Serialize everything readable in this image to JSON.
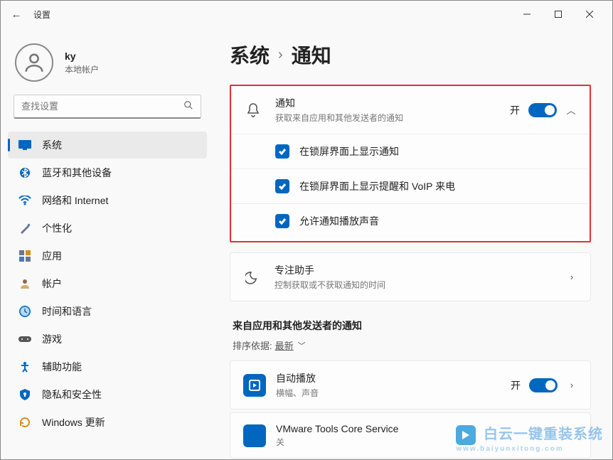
{
  "window": {
    "title": "设置"
  },
  "user": {
    "name": "ky",
    "type": "本地帐户"
  },
  "search": {
    "placeholder": "查找设置"
  },
  "nav": {
    "items": [
      {
        "label": "系统",
        "iconColor": "#0067c0"
      },
      {
        "label": "蓝牙和其他设备",
        "iconColor": "#0067c0"
      },
      {
        "label": "网络和 Internet",
        "iconColor": "#0067c0"
      },
      {
        "label": "个性化",
        "iconColor": "#6b768f"
      },
      {
        "label": "应用",
        "iconColor": "#6b768f"
      },
      {
        "label": "帐户",
        "iconColor": "#8c6a4f"
      },
      {
        "label": "时间和语言",
        "iconColor": "#0067c0"
      },
      {
        "label": "游戏",
        "iconColor": "#777"
      },
      {
        "label": "辅助功能",
        "iconColor": "#0067c0"
      },
      {
        "label": "隐私和安全性",
        "iconColor": "#0067c0"
      },
      {
        "label": "Windows 更新",
        "iconColor": "#d88b1e"
      }
    ]
  },
  "breadcrumb": {
    "root": "系统",
    "current": "通知"
  },
  "notifications": {
    "title": "通知",
    "subtitle": "获取来自应用和其他发送者的通知",
    "stateLabel": "开",
    "options": [
      "在锁屏界面上显示通知",
      "在锁屏界面上显示提醒和 VoIP 来电",
      "允许通知播放声音"
    ]
  },
  "focus": {
    "title": "专注助手",
    "subtitle": "控制获取或不获取通知的时间"
  },
  "senders": {
    "title": "来自应用和其他发送者的通知",
    "sortPrefix": "排序依据:",
    "sortValue": "最新",
    "apps": [
      {
        "name": "自动播放",
        "desc": "横幅、声音",
        "state": "开"
      },
      {
        "name": "VMware Tools Core Service",
        "desc": "关",
        "state": ""
      }
    ]
  },
  "watermark": {
    "brand": "白云一键重装系统",
    "url": "www.baiyunxitong.com"
  }
}
